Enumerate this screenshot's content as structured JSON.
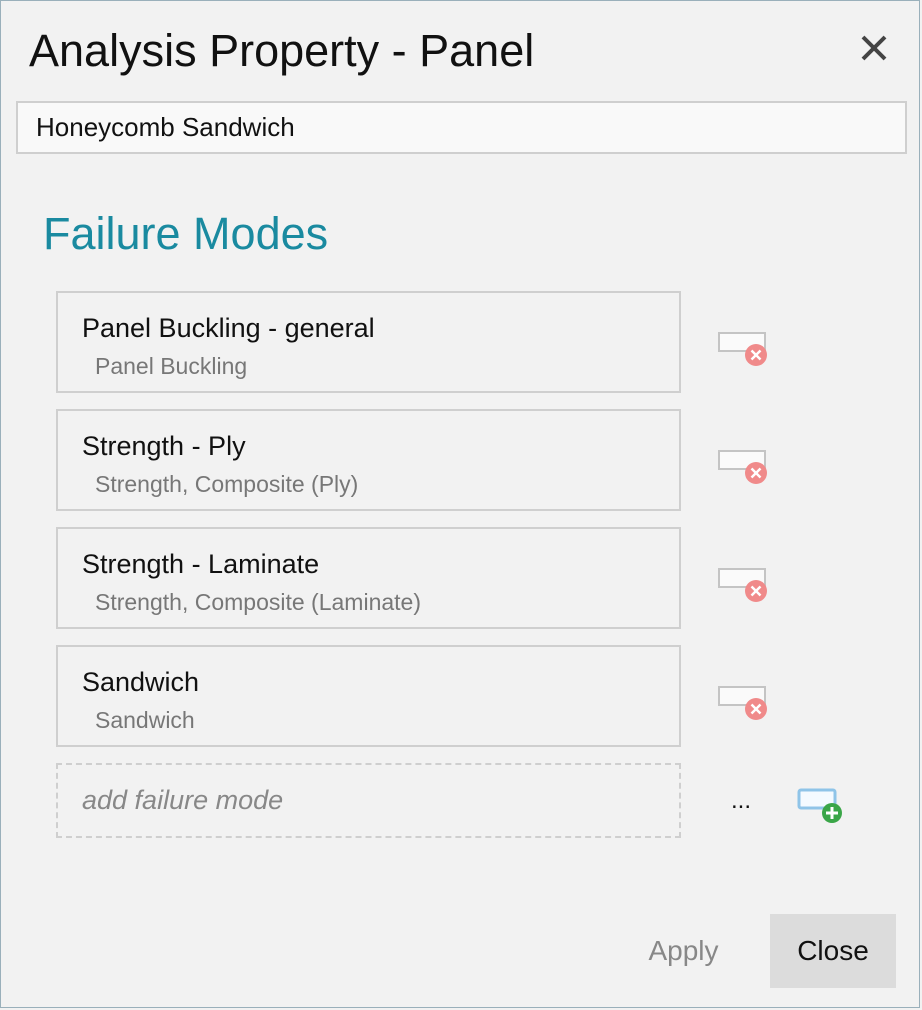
{
  "dialog": {
    "title": "Analysis Property - Panel",
    "close_icon": "close-icon"
  },
  "property_name": {
    "value": "Honeycomb Sandwich"
  },
  "failure_modes": {
    "heading": "Failure Modes",
    "items": [
      {
        "name": "Panel Buckling - general",
        "type": "Panel Buckling"
      },
      {
        "name": "Strength - Ply",
        "type": "Strength, Composite (Ply)"
      },
      {
        "name": "Strength - Laminate",
        "type": "Strength, Composite (Laminate)"
      },
      {
        "name": "Sandwich",
        "type": "Sandwich"
      }
    ],
    "add_placeholder": "add failure mode",
    "browse_label": "...",
    "remove_icon": "remove-item-icon",
    "add_icon": "add-item-icon"
  },
  "footer": {
    "apply_label": "Apply",
    "close_label": "Close"
  },
  "colors": {
    "accent": "#1a8aa0",
    "remove": "#f08080",
    "add": "#3aa648",
    "add_box": "#8fc4e8"
  }
}
